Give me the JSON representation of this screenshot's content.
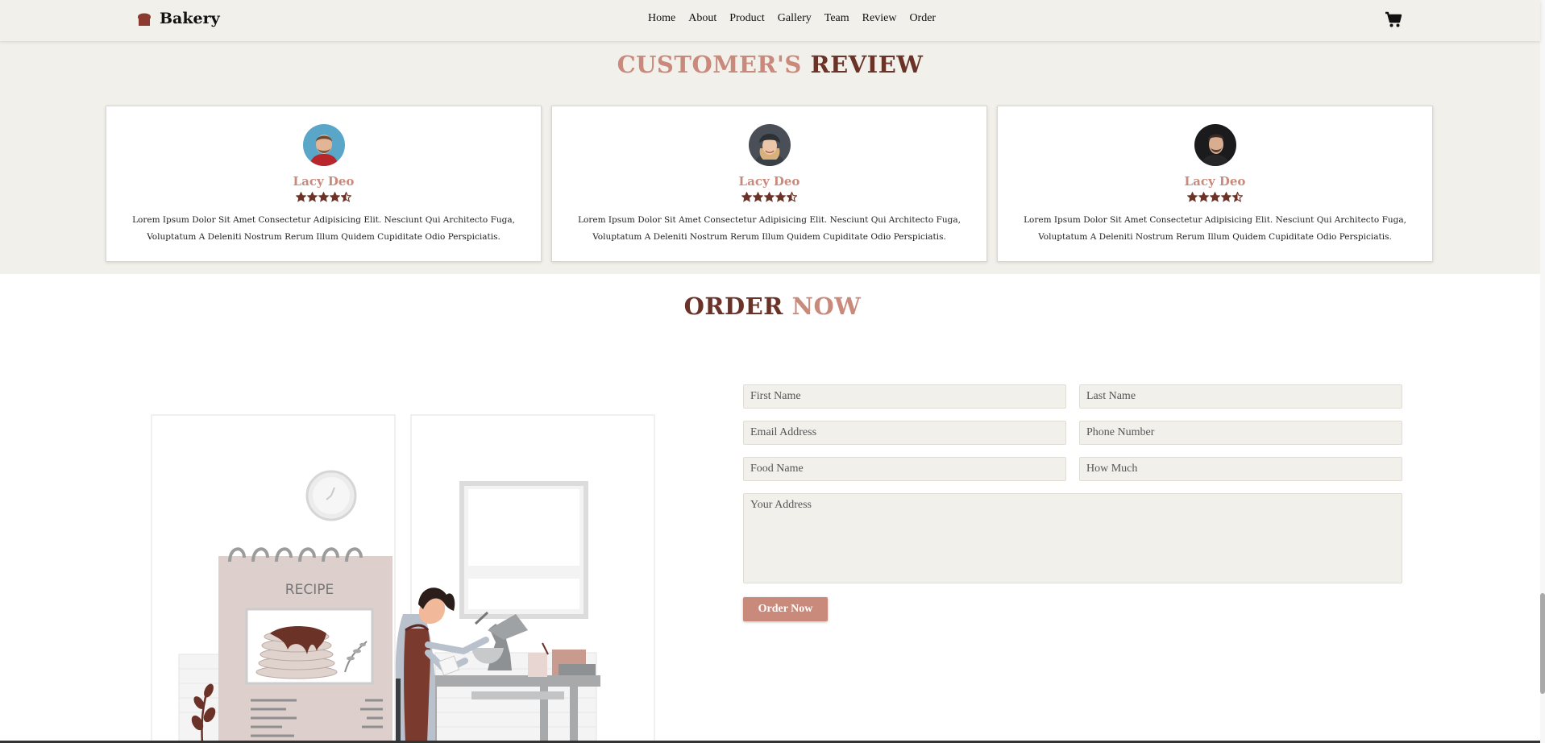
{
  "header": {
    "brand": "Bakery",
    "logo_icon": "bread-icon",
    "nav": [
      {
        "label": "Home"
      },
      {
        "label": "About"
      },
      {
        "label": "Product"
      },
      {
        "label": "Gallery"
      },
      {
        "label": "Team"
      },
      {
        "label": "Review"
      },
      {
        "label": "Order"
      }
    ],
    "cart_icon": "cart-icon"
  },
  "reviews": {
    "title_part1": "CUSTOMER'S",
    "title_part2": "REVIEW",
    "rating": 4.5,
    "cards": [
      {
        "name": "Lacy Deo",
        "text": "Lorem Ipsum Dolor Sit Amet Consectetur Adipisicing Elit. Nesciunt Qui Architecto Fuga, Voluptatum A Deleniti Nostrum Rerum Illum Quidem Cupiditate Odio Perspiciatis."
      },
      {
        "name": "Lacy Deo",
        "text": "Lorem Ipsum Dolor Sit Amet Consectetur Adipisicing Elit. Nesciunt Qui Architecto Fuga, Voluptatum A Deleniti Nostrum Rerum Illum Quidem Cupiditate Odio Perspiciatis."
      },
      {
        "name": "Lacy Deo",
        "text": "Lorem Ipsum Dolor Sit Amet Consectetur Adipisicing Elit. Nesciunt Qui Architecto Fuga, Voluptatum A Deleniti Nostrum Rerum Illum Quidem Cupiditate Odio Perspiciatis."
      }
    ]
  },
  "order": {
    "title_part1": "ORDER",
    "title_part2": "NOW",
    "illustration_text": "RECIPE",
    "fields": {
      "first_name": "First Name",
      "last_name": "Last Name",
      "email": "Email Address",
      "phone": "Phone Number",
      "food": "Food Name",
      "how_much": "How Much",
      "address": "Your Address"
    },
    "submit_label": "Order Now"
  },
  "colors": {
    "accent": "#c98a7c",
    "dark_accent": "#6b3228",
    "section_bg": "#f2f0eb"
  }
}
